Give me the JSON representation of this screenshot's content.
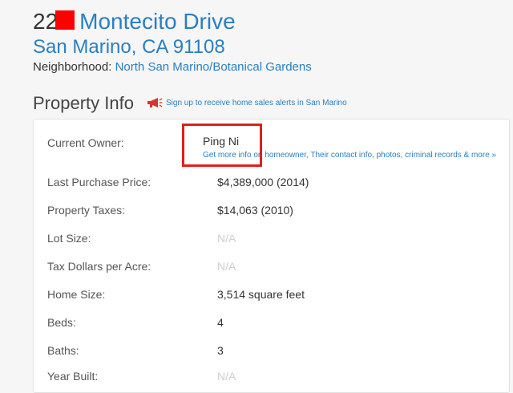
{
  "address": {
    "number": "22",
    "street": "Montecito Drive",
    "city_line": "San Marino, CA 91108",
    "neighborhood_label": "Neighborhood:",
    "neighborhood": "North San Marino/Botanical Gardens"
  },
  "section": {
    "title": "Property Info",
    "alert_icon": "megaphone-icon",
    "alert_text": "Sign up to receive home sales alerts in San Marino"
  },
  "owner": {
    "label": "Current Owner:",
    "name": "Ping Ni",
    "more_link": "Get more info on homeowner, Their contact info, photos, criminal records & more »"
  },
  "rows": [
    {
      "label": "Last Purchase Price:",
      "value": "$4,389,000 (2014)"
    },
    {
      "label": "Property Taxes:",
      "value": "$14,063 (2010)"
    },
    {
      "label": "Lot Size:",
      "value": "N/A"
    },
    {
      "label": "Tax Dollars per Acre:",
      "value": "N/A"
    },
    {
      "label": "Home Size:",
      "value": "3,514 square feet"
    },
    {
      "label": "Beds:",
      "value": "4"
    },
    {
      "label": "Baths:",
      "value": "3"
    },
    {
      "label": "Year Built:",
      "value": "N/A"
    }
  ],
  "colors": {
    "link": "#2a7fc1",
    "highlight_box": "#e0201b",
    "redaction": "#ff0000",
    "na_text": "#cfcfcf"
  }
}
